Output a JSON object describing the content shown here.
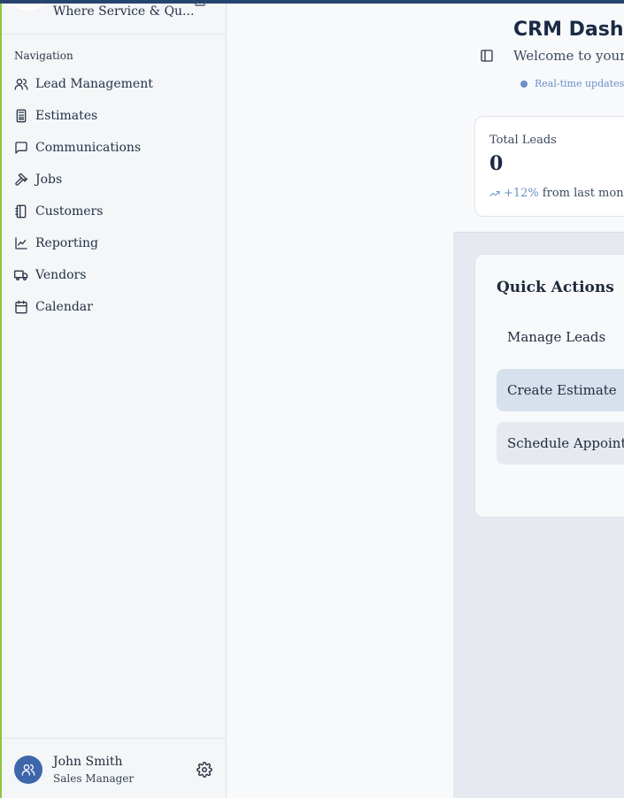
{
  "brand": {
    "tagline": "Where Service & Qu..."
  },
  "nav": {
    "heading": "Navigation",
    "items": [
      {
        "label": "Lead Management",
        "icon": "users-icon"
      },
      {
        "label": "Estimates",
        "icon": "calculator-icon"
      },
      {
        "label": "Communications",
        "icon": "message-icon"
      },
      {
        "label": "Jobs",
        "icon": "hammer-icon"
      },
      {
        "label": "Customers",
        "icon": "contacts-icon"
      },
      {
        "label": "Reporting",
        "icon": "chart-line-icon"
      },
      {
        "label": "Vendors",
        "icon": "truck-icon"
      },
      {
        "label": "Calendar",
        "icon": "calendar-icon"
      }
    ]
  },
  "user": {
    "name": "John Smith",
    "role": "Sales Manager"
  },
  "header": {
    "title": "CRM Dashb",
    "subtitle": "Welcome to your",
    "live_text": "Real-time updates"
  },
  "stats": {
    "total_leads": {
      "label": "Total Leads",
      "value": "0",
      "trend_pct": "+12%",
      "trend_text": "from last month"
    }
  },
  "quick_actions": {
    "title": "Quick Actions",
    "buttons": [
      {
        "label": "Manage Leads"
      },
      {
        "label": "Create Estimate"
      },
      {
        "label": "Schedule Appoint"
      }
    ]
  },
  "colors": {
    "accent": "#3e67ab",
    "frame_green": "#8cc63f",
    "frame_top": "#27446e",
    "live_blue": "#6b8fc9"
  }
}
